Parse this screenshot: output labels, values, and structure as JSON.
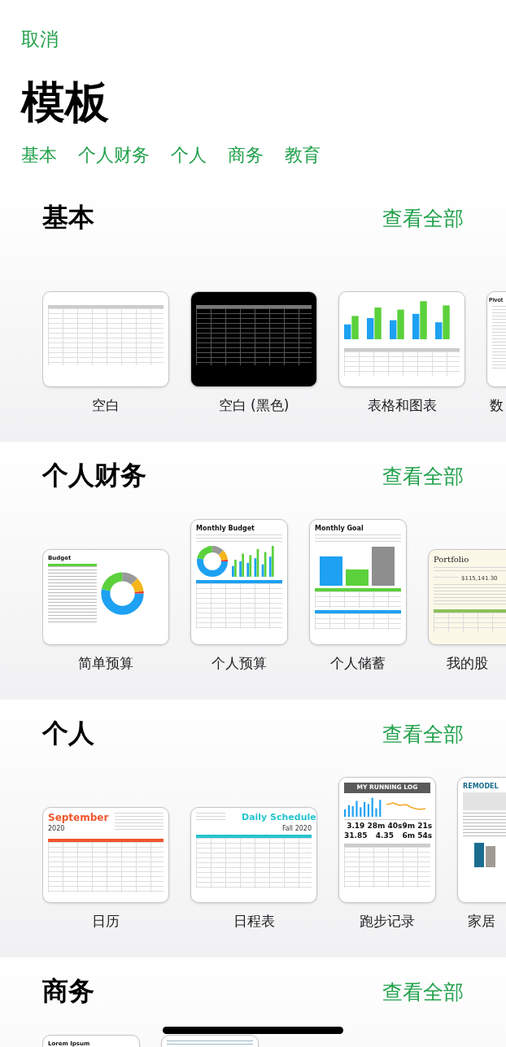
{
  "cancel": "取消",
  "title": "模板",
  "categories": [
    {
      "label": "基本"
    },
    {
      "label": "个人财务"
    },
    {
      "label": "个人"
    },
    {
      "label": "商务"
    },
    {
      "label": "教育"
    }
  ],
  "sections": [
    {
      "title": "基本",
      "see_all": "查看全部",
      "templates": [
        {
          "label": "空白",
          "kind": "blank"
        },
        {
          "label": "空白 (黑色)",
          "kind": "blank_dark"
        },
        {
          "label": "表格和图表",
          "kind": "chart_table"
        },
        {
          "label": "数",
          "kind": "text_doc",
          "heading": "Pivot"
        }
      ]
    },
    {
      "title": "个人财务",
      "see_all": "查看全部",
      "templates": [
        {
          "label": "简单预算",
          "kind": "budget",
          "heading": "Budget"
        },
        {
          "label": "个人预算",
          "kind": "monthly_budget",
          "heading": "Monthly Budget"
        },
        {
          "label": "个人储蓄",
          "kind": "monthly_goal",
          "heading": "Monthly Goal"
        },
        {
          "label": "我的股",
          "kind": "portfolio",
          "heading": "Portfolio",
          "value": "$115,141.30"
        }
      ]
    },
    {
      "title": "个人",
      "see_all": "查看全部",
      "templates": [
        {
          "label": "日历",
          "kind": "calendar",
          "heading": "September",
          "subheading": "2020"
        },
        {
          "label": "日程表",
          "kind": "schedule",
          "heading": "Daily Schedule",
          "subheading": "Fall 2020"
        },
        {
          "label": "跑步记录",
          "kind": "running_log",
          "heading": "MY RUNNING LOG",
          "stats": [
            "3.19",
            "28m 40s",
            "9m 21s",
            "31.85",
            "4.35",
            "6m 54s"
          ]
        },
        {
          "label": "家居",
          "kind": "remodel",
          "heading": "REMODEL"
        }
      ]
    },
    {
      "title": "商务",
      "see_all": "查看全部",
      "templates": [
        {
          "kind": "lorem",
          "heading": "Lorem Ipsum"
        },
        {
          "kind": "plain"
        }
      ]
    }
  ]
}
